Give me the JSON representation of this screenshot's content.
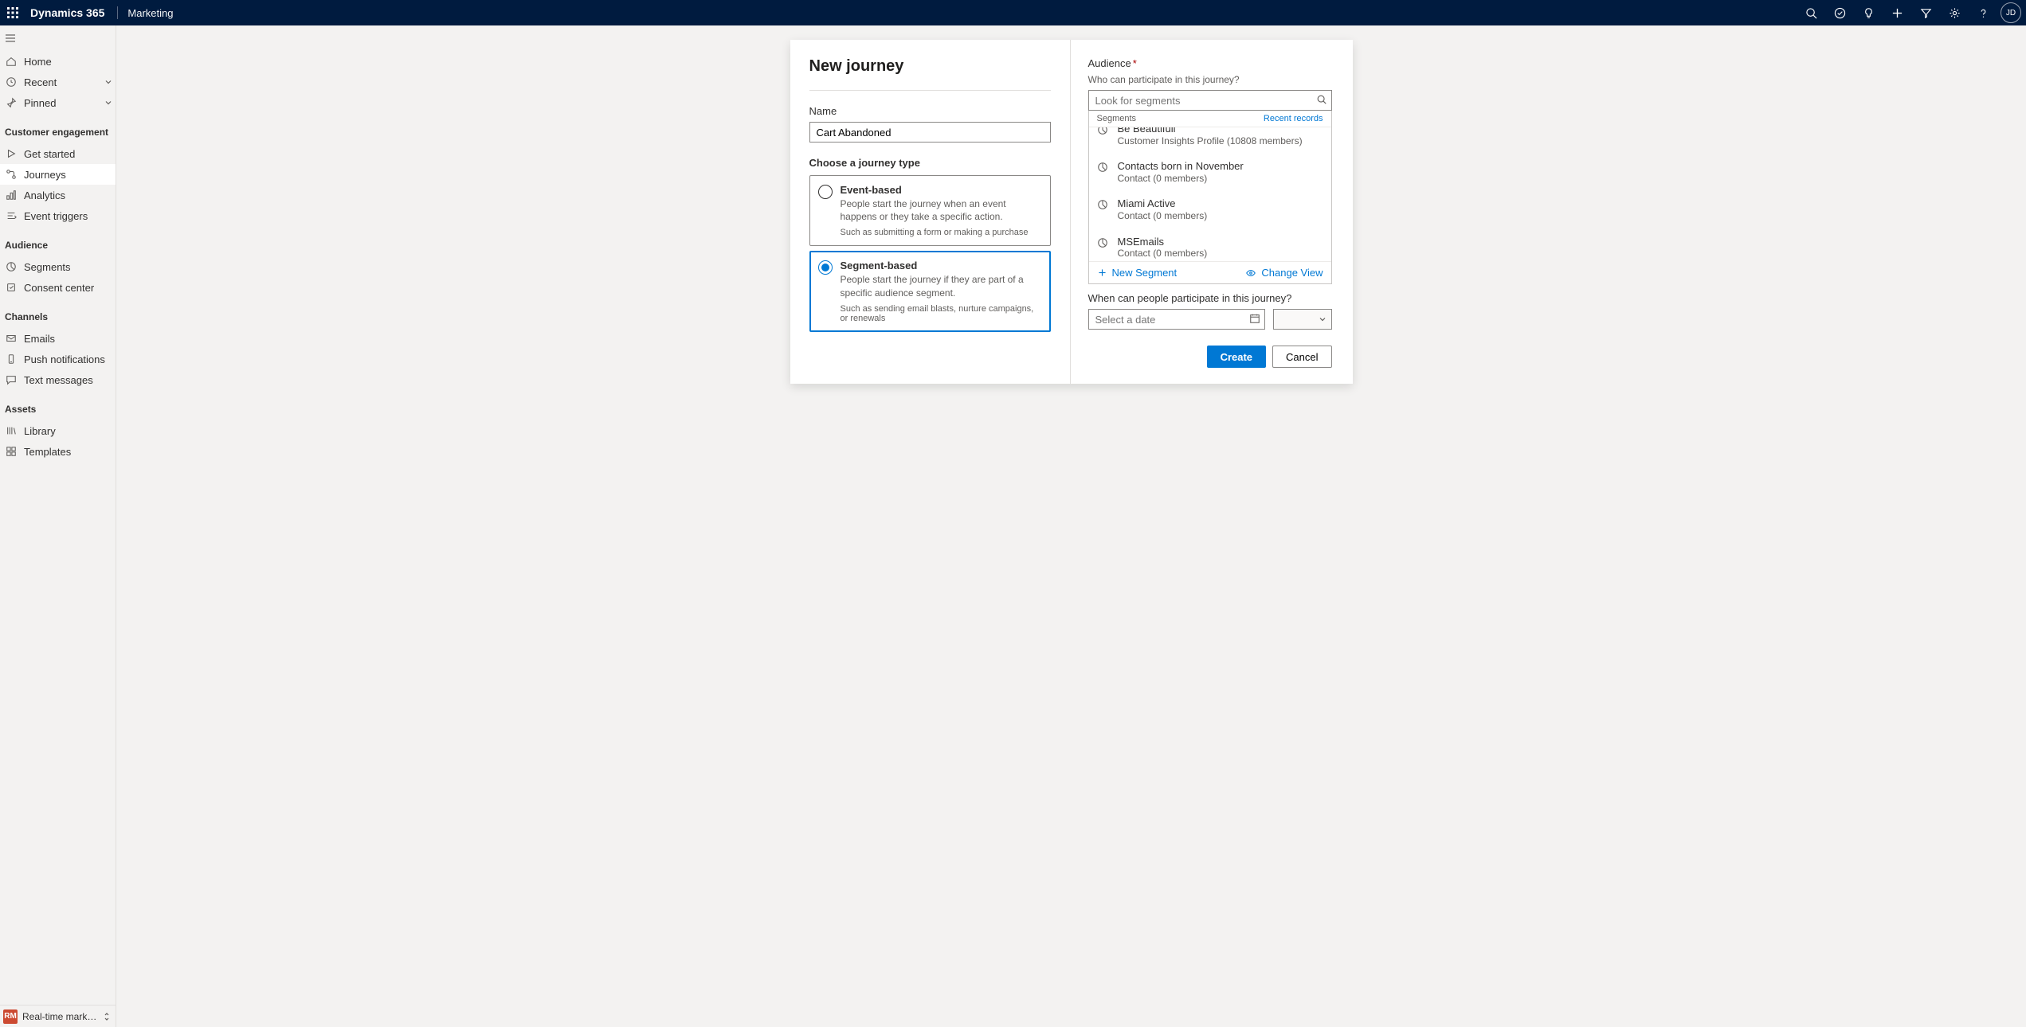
{
  "header": {
    "brand": "Dynamics 365",
    "area": "Marketing",
    "avatar_initials": "JD"
  },
  "sidebar": {
    "home": "Home",
    "recent": "Recent",
    "pinned": "Pinned",
    "sections": {
      "engagement": "Customer engagement",
      "audience": "Audience",
      "channels": "Channels",
      "assets": "Assets"
    },
    "items": {
      "get_started": "Get started",
      "journeys": "Journeys",
      "analytics": "Analytics",
      "event_triggers": "Event triggers",
      "segments": "Segments",
      "consent_center": "Consent center",
      "emails": "Emails",
      "push": "Push notifications",
      "text_messages": "Text messages",
      "library": "Library",
      "templates": "Templates"
    },
    "area_switch": {
      "badge": "RM",
      "label": "Real-time marketi..."
    }
  },
  "dialog": {
    "title": "New journey",
    "name_label": "Name",
    "name_value": "Cart Abandoned",
    "type_heading": "Choose a journey type",
    "opt_event": {
      "title": "Event-based",
      "desc": "People start the journey when an event happens or they take a specific action.",
      "example": "Such as submitting a form or making a purchase"
    },
    "opt_segment": {
      "title": "Segment-based",
      "desc": "People start the journey if they are part of a specific audience segment.",
      "example": "Such as sending email blasts, nurture campaigns, or renewals"
    },
    "audience_label": "Audience",
    "audience_hint": "Who can participate in this journey?",
    "lookup_placeholder": "Look for segments",
    "dd_head_left": "Segments",
    "dd_head_right": "Recent records",
    "segments": [
      {
        "name": "Be Beautifull",
        "sub": "Customer Insights Profile (10808 members)"
      },
      {
        "name": "Contacts born in November",
        "sub": "Contact (0 members)"
      },
      {
        "name": "Miami Active",
        "sub": "Contact (0 members)"
      },
      {
        "name": "MSEmails",
        "sub": "Contact (0 members)"
      }
    ],
    "new_segment": "New Segment",
    "change_view": "Change View",
    "when_label": "When can people participate in this journey?",
    "date_placeholder": "Select a date",
    "btn_create": "Create",
    "btn_cancel": "Cancel"
  }
}
